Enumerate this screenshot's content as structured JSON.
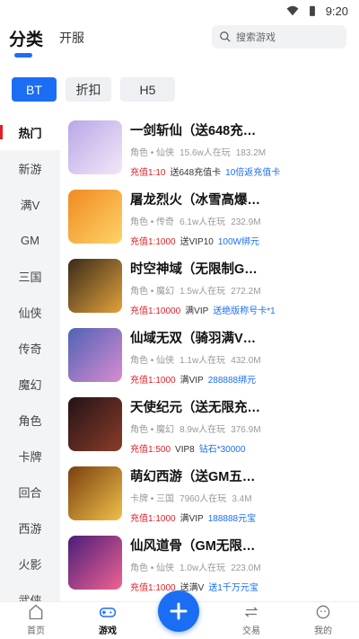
{
  "status": {
    "time": "9:20"
  },
  "header": {
    "tab_category": "分类",
    "tab_server": "开服",
    "search_placeholder": "搜索游戏"
  },
  "chips": [
    "BT",
    "折扣",
    "H5"
  ],
  "sidebar": [
    "热门",
    "新游",
    "满V",
    "GM",
    "三国",
    "仙侠",
    "传奇",
    "魔幻",
    "角色",
    "卡牌",
    "回合",
    "西游",
    "火影",
    "武侠"
  ],
  "games": [
    {
      "title": "一剑斩仙（送648充…",
      "genre": "角色 • 仙侠",
      "players": "15.6w人在玩",
      "size": "183.2M",
      "tag1": "充值1:10",
      "tag2": "送648充值卡",
      "tag3": "10倍返充值卡"
    },
    {
      "title": "屠龙烈火（冰雪高爆…",
      "genre": "角色 • 传奇",
      "players": "6.1w人在玩",
      "size": "232.9M",
      "tag1": "充值1:1000",
      "tag2": "送VIP10",
      "tag3": "100W绑元"
    },
    {
      "title": "时空神域（无限制G…",
      "genre": "角色 • 魔幻",
      "players": "1.5w人在玩",
      "size": "272.2M",
      "tag1": "充值1:10000",
      "tag2": "满VIP",
      "tag3": "送绝版称号卡*1"
    },
    {
      "title": "仙域无双（骑羽满V…",
      "genre": "角色 • 仙侠",
      "players": "1.1w人在玩",
      "size": "432.0M",
      "tag1": "充值1:1000",
      "tag2": "满VIP",
      "tag3": "288888绑元"
    },
    {
      "title": "天使纪元（送无限充…",
      "genre": "角色 • 魔幻",
      "players": "8.9w人在玩",
      "size": "376.9M",
      "tag1": "充值1:500",
      "tag2": "VIP8",
      "tag3": "钻石*30000"
    },
    {
      "title": "萌幻西游（送GM五…",
      "genre": "卡牌 • 三国",
      "players": "7960人在玩",
      "size": "3.4M",
      "tag1": "充值1:1000",
      "tag2": "满VIP",
      "tag3": "188888元宝"
    },
    {
      "title": "仙风道骨（GM无限…",
      "genre": "角色 • 仙侠",
      "players": "1.0w人在玩",
      "size": "223.0M",
      "tag1": "充值1:1000",
      "tag2": "送满V",
      "tag3": "送1千万元宝"
    }
  ],
  "thumb_colors": [
    [
      "#b9a7e8",
      "#f3e7f7"
    ],
    [
      "#f08a1f",
      "#ffd36a"
    ],
    [
      "#3a2a1a",
      "#e2a23b"
    ],
    [
      "#4f63b5",
      "#d88bd1"
    ],
    [
      "#231215",
      "#8a3d2a"
    ],
    [
      "#7a3f10",
      "#f0c04a"
    ],
    [
      "#4a1d7a",
      "#f06292"
    ]
  ],
  "bottom_nav": [
    "首页",
    "游戏",
    "",
    "交易",
    "我的"
  ]
}
